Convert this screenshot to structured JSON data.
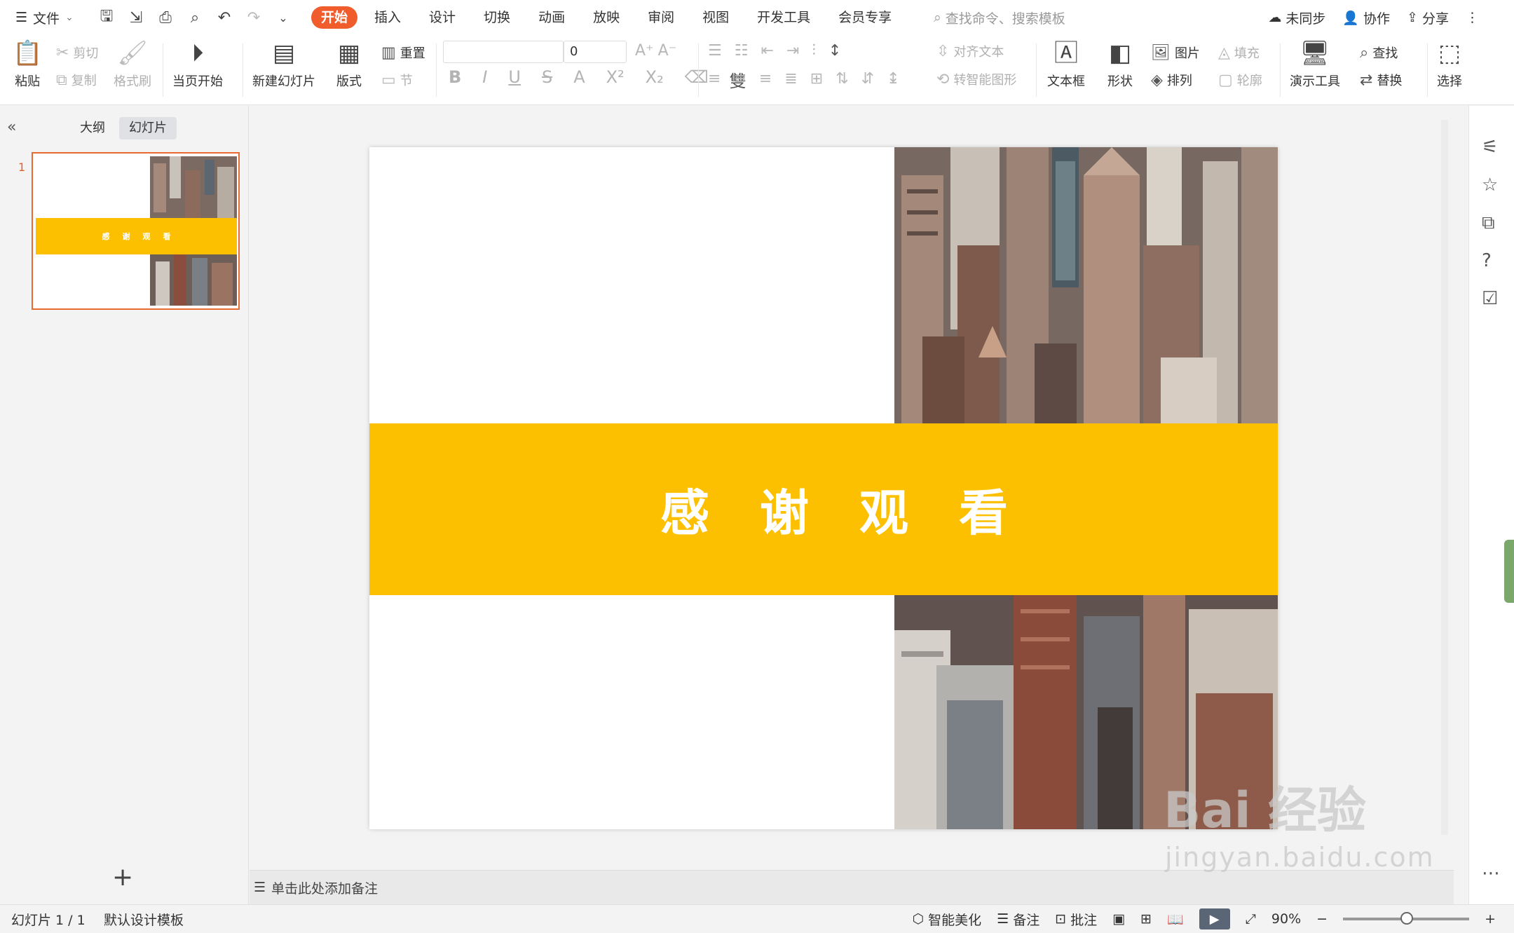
{
  "menubar": {
    "file_label": "文件",
    "tabs": [
      "开始",
      "插入",
      "设计",
      "切换",
      "动画",
      "放映",
      "审阅",
      "视图",
      "开发工具",
      "会员专享"
    ],
    "search_placeholder": "查找命令、搜索模板",
    "sync_label": "未同步",
    "collab_label": "协作",
    "share_label": "分享"
  },
  "ribbon": {
    "paste": "粘贴",
    "cut": "剪切",
    "copy": "复制",
    "format_painter": "格式刷",
    "from_current": "当页开始",
    "new_slide": "新建幻灯片",
    "layout": "版式",
    "reset": "重置",
    "section": "节",
    "font_size": "0",
    "align_text": "对齐文本",
    "smart_shape": "转智能图形",
    "textbox": "文本框",
    "shape": "形状",
    "picture": "图片",
    "fill": "填充",
    "arrange": "排列",
    "outline": "轮廓",
    "present_tools": "演示工具",
    "find": "查找",
    "replace": "替换",
    "select": "选择"
  },
  "leftpanel": {
    "tab_outline": "大纲",
    "tab_slides": "幻灯片",
    "slide_number": "1"
  },
  "slide": {
    "title_chars": [
      "感",
      "谢",
      "观",
      "看"
    ],
    "band_color": "#fcc000"
  },
  "notes": {
    "placeholder": "单击此处添加备注"
  },
  "status": {
    "slide_count": "幻灯片 1 / 1",
    "template": "默认设计模板",
    "beautify": "智能美化",
    "notes": "备注",
    "comments": "批注",
    "zoom": "90%",
    "zoom_level": 0.5
  },
  "watermark": {
    "logo": "Bai 经验",
    "url": "jingyan.baidu.com"
  }
}
